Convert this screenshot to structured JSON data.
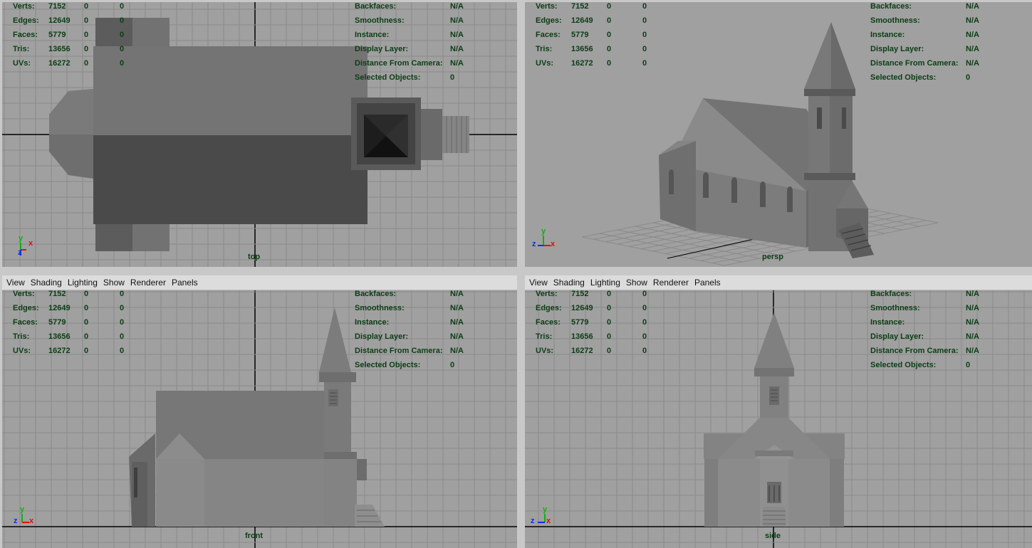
{
  "menu": [
    "View",
    "Shading",
    "Lighting",
    "Show",
    "Renderer",
    "Panels"
  ],
  "hud_left": [
    {
      "label": "Verts:",
      "v1": "7152",
      "v2": "0",
      "v3": "0"
    },
    {
      "label": "Edges:",
      "v1": "12649",
      "v2": "0",
      "v3": "0"
    },
    {
      "label": "Faces:",
      "v1": "5779",
      "v2": "0",
      "v3": "0"
    },
    {
      "label": "Tris:",
      "v1": "13656",
      "v2": "0",
      "v3": "0"
    },
    {
      "label": "UVs:",
      "v1": "16272",
      "v2": "0",
      "v3": "0"
    }
  ],
  "hud_right": [
    {
      "label": "Backfaces:",
      "val": "N/A"
    },
    {
      "label": "Smoothness:",
      "val": "N/A"
    },
    {
      "label": "Instance:",
      "val": "N/A"
    },
    {
      "label": "Display Layer:",
      "val": "N/A"
    },
    {
      "label": "Distance From Camera:",
      "val": "N/A"
    },
    {
      "label": "Selected Objects:",
      "val": "0"
    }
  ],
  "panes": {
    "top": {
      "camera": "top"
    },
    "persp": {
      "camera": "persp"
    },
    "front": {
      "camera": "front"
    },
    "side": {
      "camera": "side"
    }
  },
  "axes": {
    "x": "x",
    "y": "y",
    "z": "z"
  },
  "colors": {
    "viewport_bg": "#a0a0a0",
    "grid": "#8a8a8a",
    "hud_text": "#0b3d14",
    "axis_x": "#e01010",
    "axis_y": "#10b010",
    "axis_z": "#1030e0"
  }
}
